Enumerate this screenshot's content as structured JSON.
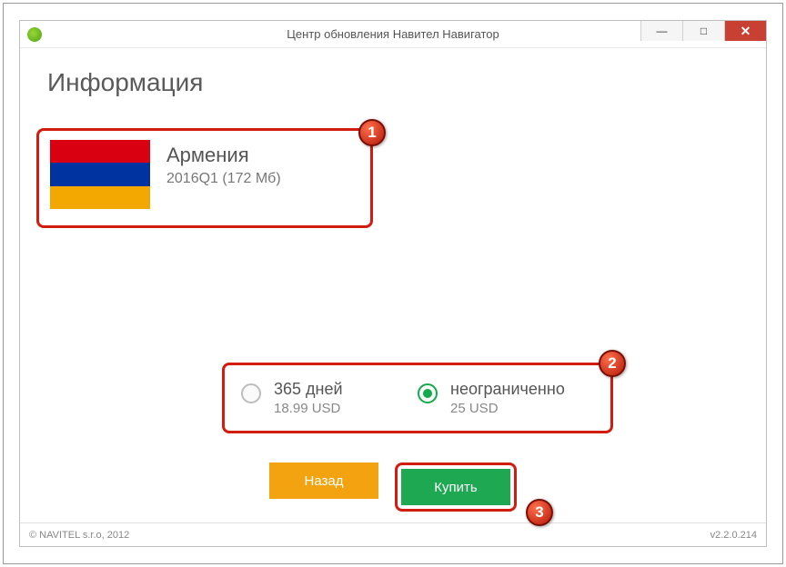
{
  "window": {
    "title": "Центр обновления Навител Навигатор"
  },
  "page": {
    "heading": "Информация"
  },
  "product": {
    "name": "Армения",
    "meta": "2016Q1 (172 Мб)"
  },
  "options": [
    {
      "label": "365 дней",
      "price": "18.99 USD",
      "selected": false
    },
    {
      "label": "неограниченно",
      "price": "25 USD",
      "selected": true
    }
  ],
  "buttons": {
    "back": "Назад",
    "buy": "Купить"
  },
  "footer": {
    "copyright": "© NAVITEL s.r.o, 2012",
    "version": "v2.2.0.214"
  },
  "badges": [
    "1",
    "2",
    "3"
  ]
}
